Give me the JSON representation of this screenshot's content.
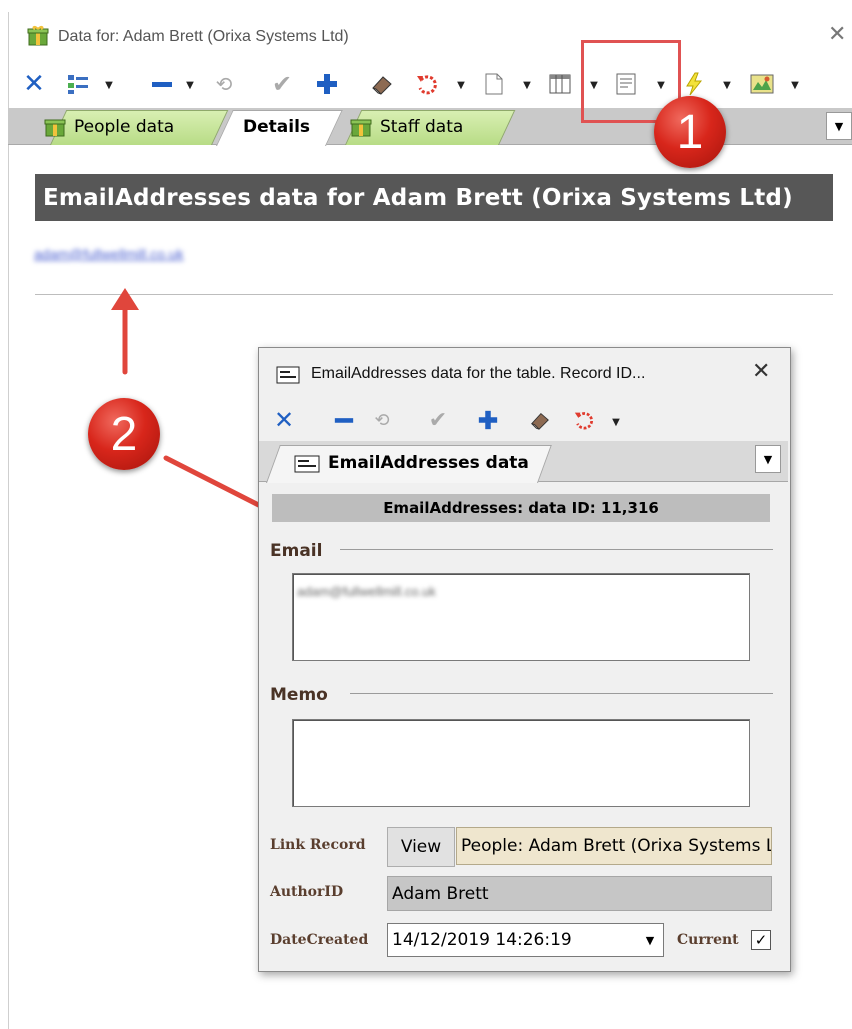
{
  "window": {
    "title": "Data for: Adam Brett (Orixa Systems Ltd)",
    "close_glyph": "✕"
  },
  "toolbar": {
    "icons": [
      "close-x-icon",
      "grid-options-icon",
      "minus-icon",
      "refresh-icon",
      "checkmark-icon",
      "plus-icon",
      "eraser-icon",
      "undo-icon",
      "document-icon",
      "columns-icon",
      "form-view-icon",
      "lightning-icon",
      "map-icon"
    ]
  },
  "tabs": [
    {
      "label": "People data",
      "active": false
    },
    {
      "label": "Details",
      "active": true
    },
    {
      "label": "Staff data",
      "active": false
    }
  ],
  "section_header": "EmailAddresses data for Adam Brett (Orixa Systems Ltd)",
  "email_link": "adam@fullwellmill.co.uk",
  "annotations": {
    "badge_1": "1",
    "badge_2": "2"
  },
  "dialog": {
    "title": "EmailAddresses data for the  table. Record ID...",
    "close_glyph": "✕",
    "tab_label": "EmailAddresses data",
    "record_bar": "EmailAddresses: data ID: 11,316",
    "email_section": "Email",
    "email_value": "adam@fullwellmill.co.uk",
    "memo_section": "Memo",
    "memo_value": "",
    "link_record_label": "Link Record",
    "view_button": "View",
    "link_value": "People: Adam Brett (Orixa Systems Ltd)",
    "author_label": "AuthorID",
    "author_value": "Adam Brett",
    "date_label": "DateCreated",
    "date_value": "14/12/2019 14:26:19",
    "current_label": "Current",
    "current_checked": true
  },
  "colors": {
    "header_bg": "#575757",
    "tab_green": "#c7e39b",
    "annotation_red": "#e05252",
    "link_value_bg": "#efe6ce"
  }
}
